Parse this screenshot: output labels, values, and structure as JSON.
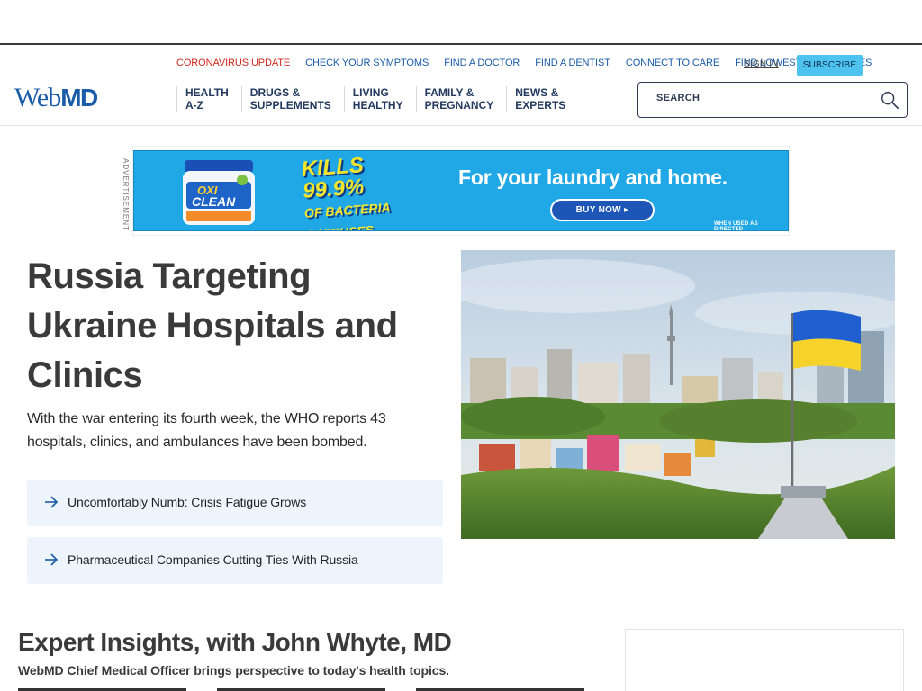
{
  "utility_links": [
    {
      "label": "CORONAVIRUS UPDATE",
      "highlight": true
    },
    {
      "label": "CHECK YOUR SYMPTOMS"
    },
    {
      "label": "FIND A DOCTOR"
    },
    {
      "label": "FIND A DENTIST"
    },
    {
      "label": "CONNECT TO CARE"
    },
    {
      "label": "FIND LOWEST DRUG PRICES"
    }
  ],
  "account": {
    "sign_in": "SIGN IN",
    "subscribe": "SUBSCRIBE"
  },
  "logo": {
    "web": "Web",
    "md": "MD"
  },
  "main_nav": [
    {
      "label": "HEALTH\nA-Z"
    },
    {
      "label": "DRUGS &\nSUPPLEMENTS"
    },
    {
      "label": "LIVING\nHEALTHY"
    },
    {
      "label": "FAMILY &\nPREGNANCY"
    },
    {
      "label": "NEWS &\nEXPERTS"
    }
  ],
  "search": {
    "placeholder": "SEARCH"
  },
  "advertisement": {
    "label": "ADVERTISEMENT",
    "kills_line1": "KILLS 99.9%",
    "kills_line2": "OF BACTERIA",
    "kills_line3": "& VIRUSES",
    "tagline": "For your laundry and home.",
    "button": "BUY NOW",
    "fine_print": "WHEN USED AS DIRECTED",
    "product_name": "OXI CLEAN"
  },
  "feature": {
    "headline": "Russia Targeting Ukraine Hospitals and Clinics",
    "dek": "With the war entering its fourth week, the WHO reports 43 hospitals, clinics, and ambulances have been bombed.",
    "related": [
      {
        "label": "Uncomfortably Numb: Crisis Fatigue Grows"
      },
      {
        "label": "Pharmaceutical Companies Cutting Ties With Russia"
      }
    ]
  },
  "expert": {
    "title": "Expert Insights, with John Whyte, MD",
    "subtitle": "WebMD Chief Medical Officer brings perspective to today's health topics."
  },
  "colors": {
    "brand_blue": "#1a5ba8",
    "alert_red": "#d0281d",
    "subscribe_bg": "#4fc3f0",
    "nav_text": "#233a5e",
    "related_bg": "#eef4fb"
  }
}
